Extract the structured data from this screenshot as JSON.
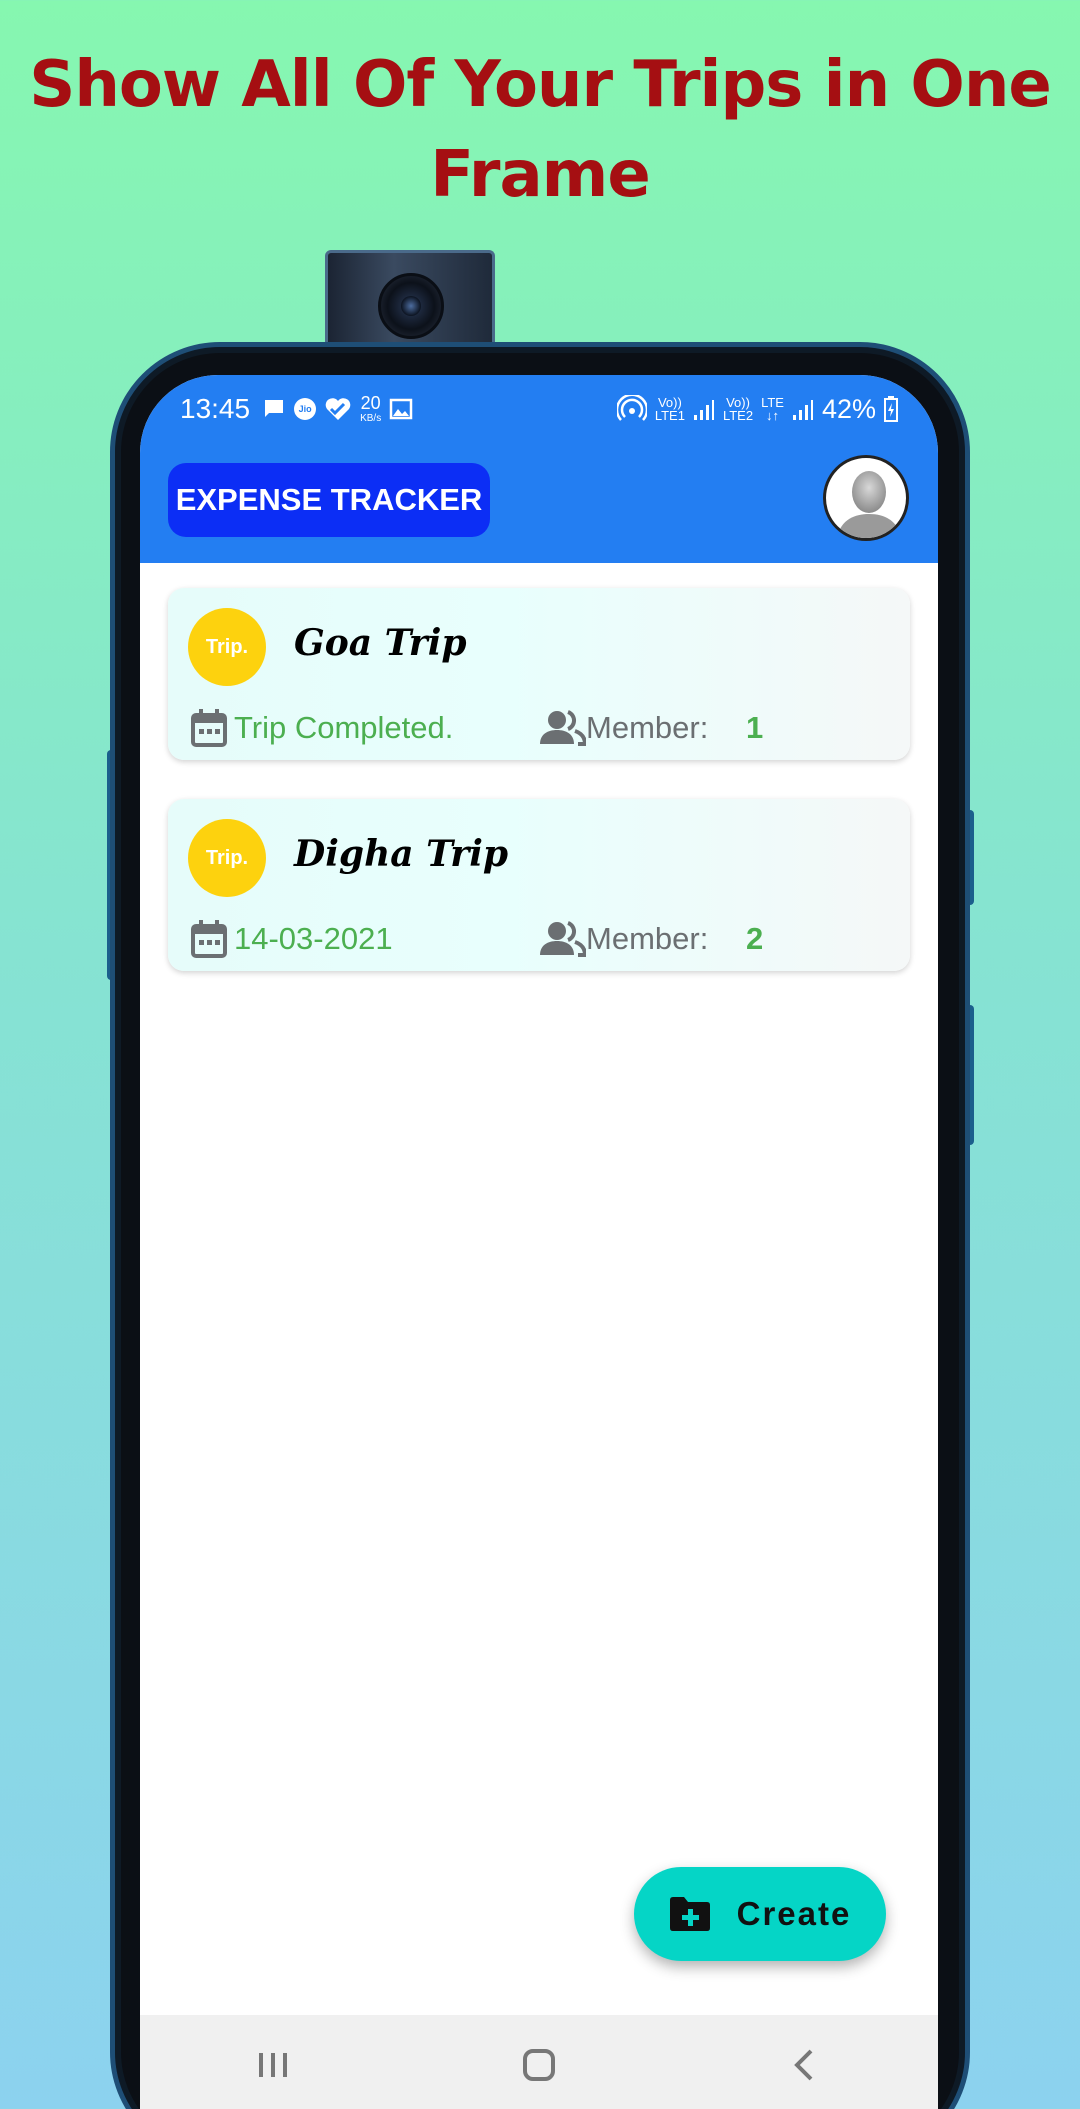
{
  "headline": {
    "line1": "Show All Of Your Trips in One",
    "line2": "Frame"
  },
  "status_bar": {
    "time": "13:45",
    "speed_value": "20",
    "speed_unit": "KB/s",
    "sim1": "LTE1",
    "sim2": "LTE2",
    "lte": "LTE",
    "volte": "Vo))",
    "battery": "42%",
    "jio": "Jio"
  },
  "app_bar": {
    "title": "EXPENSE TRACKER"
  },
  "trips": [
    {
      "logo_text": "Trip.",
      "name": "Goa Trip",
      "status": "Trip Completed.",
      "member_label": "Member:",
      "member_count": "1"
    },
    {
      "logo_text": "Trip.",
      "name": "Digha Trip",
      "status": "14-03-2021",
      "member_label": "Member:",
      "member_count": "2"
    }
  ],
  "fab": {
    "label": "Create"
  },
  "colors": {
    "headline": "#a50f12",
    "app_bar": "#237ef2",
    "title_pill": "#0c2ef5",
    "fab": "#05d5c6",
    "status_green": "#4caf50",
    "trip_logo": "#fdd20e"
  },
  "icons": {
    "calendar": "calendar-icon",
    "members": "people-icon",
    "create": "folder-plus-icon",
    "nav_recent": "recent-apps-icon",
    "nav_home": "home-icon",
    "nav_back": "back-icon"
  }
}
